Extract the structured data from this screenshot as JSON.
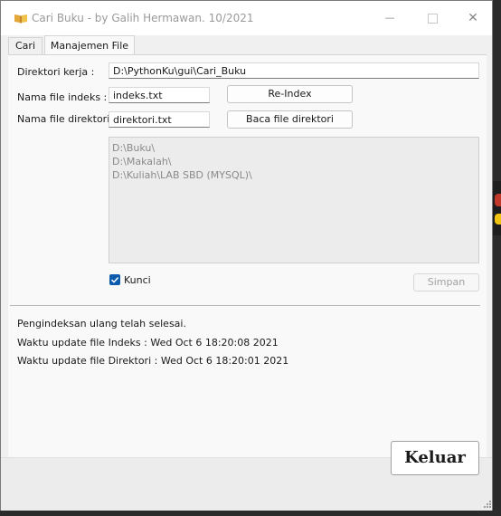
{
  "window": {
    "title": "Cari Buku - by Galih Hermawan. 10/2021",
    "minimize_glyph": "—",
    "close_glyph": "✕"
  },
  "tabs": [
    {
      "label": "Cari",
      "active": false
    },
    {
      "label": "Manajemen File",
      "active": true
    }
  ],
  "form": {
    "direktori_kerja_label": "Direktori kerja :",
    "direktori_kerja_value": "D:\\PythonKu\\gui\\Cari_Buku",
    "file_indeks_label": "Nama file indeks :",
    "file_indeks_value": "indeks.txt",
    "file_direktori_label": "Nama file direktori :",
    "file_direktori_value": "direktori.txt",
    "reindex_button": "Re-Index",
    "baca_button": "Baca file direktori",
    "directories": [
      "D:\\Buku\\",
      "D:\\Makalah\\",
      "D:\\Kuliah\\LAB SBD (MYSQL)\\"
    ],
    "kunci_label": "Kunci",
    "kunci_checked": true,
    "simpan_button": "Simpan"
  },
  "status": {
    "line1": "Pengindeksan ulang telah selesai.",
    "line2": "Waktu update file Indeks : Wed Oct  6 18:20:08 2021",
    "line3": "Waktu update file Direktori : Wed Oct  6 18:20:01 2021"
  },
  "footer": {
    "keluar_button": "Keluar"
  },
  "colors": {
    "accent": "#0b5cad"
  }
}
